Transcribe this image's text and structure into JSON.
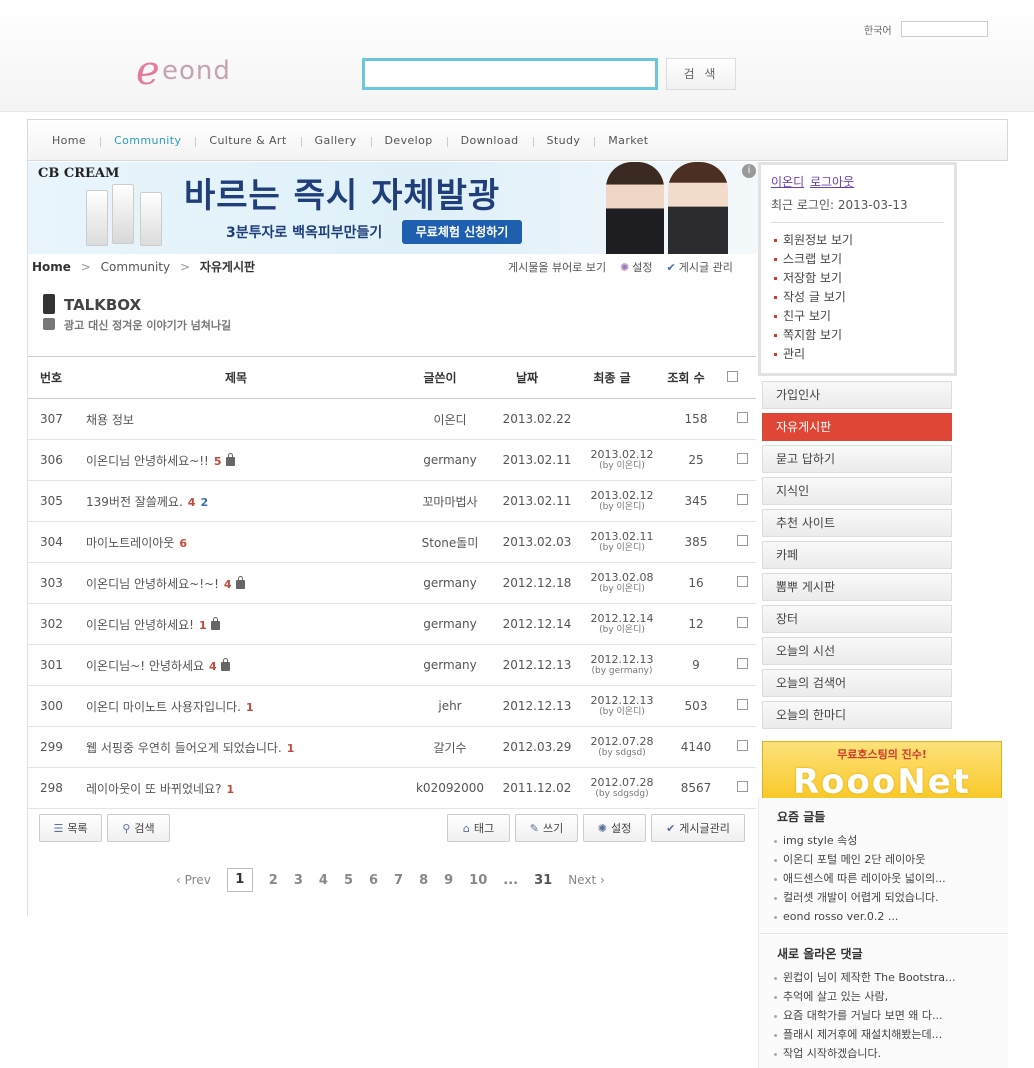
{
  "header": {
    "logo_e": "e",
    "logo_rest": "eond",
    "search_button": "검 색",
    "lang_label": "한국어"
  },
  "nav": {
    "items": [
      "Home",
      "Community",
      "Culture & Art",
      "Gallery",
      "Develop",
      "Download",
      "Study",
      "Market"
    ],
    "active": "Community"
  },
  "banner": {
    "brand": "CB CREAM",
    "headline": "바르는 즉시 자체발광",
    "sub": "3분투자로 백옥피부만들기",
    "cta": "무료체험 신청하기",
    "info": "i"
  },
  "breadcrumb": {
    "home": "Home",
    "level1": "Community",
    "current": "자유게시판",
    "sep": ">"
  },
  "tools": {
    "view_mode": "게시물을 뷰어로 보기",
    "settings": "설정",
    "manage": "게시글 관리"
  },
  "board_header": {
    "title": "TALKBOX",
    "desc": "광고 대신 정겨운 이야기가 넘쳐나길"
  },
  "columns": {
    "no": "번호",
    "title": "제목",
    "author": "글쓴이",
    "date": "날짜",
    "last": "최종 글",
    "views": "조회 수"
  },
  "rows": [
    {
      "no": "307",
      "title": "채용 정보",
      "comments": "",
      "trackbacks": "",
      "locked": false,
      "author": "이온디",
      "date": "2013.02.22",
      "last_date": "",
      "last_by": "",
      "views": "158"
    },
    {
      "no": "306",
      "title": "이온디님 안녕하세요~!!",
      "comments": "5",
      "trackbacks": "",
      "locked": true,
      "author": "germany",
      "date": "2013.02.11",
      "last_date": "2013.02.12",
      "last_by": "(by 이온디)",
      "views": "25"
    },
    {
      "no": "305",
      "title": "139버전 잘쓸께요.",
      "comments": "4",
      "trackbacks": "2",
      "locked": false,
      "author": "꼬마마법사",
      "date": "2013.02.11",
      "last_date": "2013.02.12",
      "last_by": "(by 이온디)",
      "views": "345"
    },
    {
      "no": "304",
      "title": "마이노트레이아웃",
      "comments": "6",
      "trackbacks": "",
      "locked": false,
      "author": "Stone돌미",
      "date": "2013.02.03",
      "last_date": "2013.02.11",
      "last_by": "(by 이온디)",
      "views": "385"
    },
    {
      "no": "303",
      "title": "이온디님 안녕하세요~!~!",
      "comments": "4",
      "trackbacks": "",
      "locked": true,
      "author": "germany",
      "date": "2012.12.18",
      "last_date": "2013.02.08",
      "last_by": "(by 이온디)",
      "views": "16"
    },
    {
      "no": "302",
      "title": "이온디님 안녕하세요!",
      "comments": "1",
      "trackbacks": "",
      "locked": true,
      "author": "germany",
      "date": "2012.12.14",
      "last_date": "2012.12.14",
      "last_by": "(by 이온디)",
      "views": "12"
    },
    {
      "no": "301",
      "title": "이온디님~! 안녕하세요",
      "comments": "4",
      "trackbacks": "",
      "locked": true,
      "author": "germany",
      "date": "2012.12.13",
      "last_date": "2012.12.13",
      "last_by": "(by germany)",
      "views": "9"
    },
    {
      "no": "300",
      "title": "이온디 마이노트 사용자입니다.",
      "comments": "1",
      "trackbacks": "",
      "locked": false,
      "author": "jehr",
      "date": "2012.12.13",
      "last_date": "2012.12.13",
      "last_by": "(by 이온디)",
      "views": "503"
    },
    {
      "no": "299",
      "title": "웹 서핑중 우연히 들어오게 되었습니다.",
      "comments": "1",
      "trackbacks": "",
      "locked": false,
      "author": "갈기수",
      "date": "2012.03.29",
      "last_date": "2012.07.28",
      "last_by": "(by sdgsd)",
      "views": "4140"
    },
    {
      "no": "298",
      "title": "레이아웃이 또 바뀌었네요?",
      "comments": "1",
      "trackbacks": "",
      "locked": false,
      "author": "k02092000",
      "date": "2011.12.02",
      "last_date": "2012.07.28",
      "last_by": "(by sdgsdg)",
      "views": "8567"
    }
  ],
  "buttons": {
    "list": "목록",
    "search": "검색",
    "tag": "태그",
    "write": "쓰기",
    "settings": "설정",
    "manage": "게시글관리"
  },
  "pagination": {
    "prev": "‹ Prev",
    "pages": [
      "1",
      "2",
      "3",
      "4",
      "5",
      "6",
      "7",
      "8",
      "9",
      "10"
    ],
    "current": "1",
    "ellipsis": "...",
    "last": "31",
    "next": "Next ›"
  },
  "login": {
    "user": "이온디",
    "logout": "로그아웃",
    "recent_login": "최근 로그인: 2013-03-13",
    "links": [
      "회원정보 보기",
      "스크랩 보기",
      "저장함 보기",
      "작성 글 보기",
      "친구 보기",
      "쪽지함 보기",
      "관리"
    ]
  },
  "menu": {
    "items": [
      "가입인사",
      "자유게시판",
      "묻고 답하기",
      "지식인",
      "추천 사이트",
      "카페",
      "뽐뿌 게시판",
      "장터",
      "오늘의 시선",
      "오늘의 검색어",
      "오늘의 한마디"
    ],
    "active": "자유게시판"
  },
  "hosting": {
    "title": "무료호스팅의 진수!",
    "logo": "RoooNet"
  },
  "recent_posts": {
    "title": "요즘 글들",
    "items": [
      "img style 속성",
      "이온디 포털 메인 2단 레이아웃",
      "애드센스에 따른 레이아웃 넓이의...",
      "컬러셋 개발이 어렵게 되었습니다.",
      "eond rosso ver.0.2 ..."
    ]
  },
  "recent_comments": {
    "title": "새로 올라온 댓글",
    "items": [
      "윈컵이 님이 제작한 The Bootstra...",
      "추억에 살고 있는 사람,",
      "요즘 대학가를 거닐다 보면 왜 다...",
      "플래시 제거후에 재설치해봤는데...",
      "작업 시작하겠습니다."
    ]
  },
  "colors": {
    "accent": "#2a9bbf",
    "menu_active": "#e04635",
    "comment_count": "#c24a3d",
    "trackback_count": "#3a6fb5"
  }
}
